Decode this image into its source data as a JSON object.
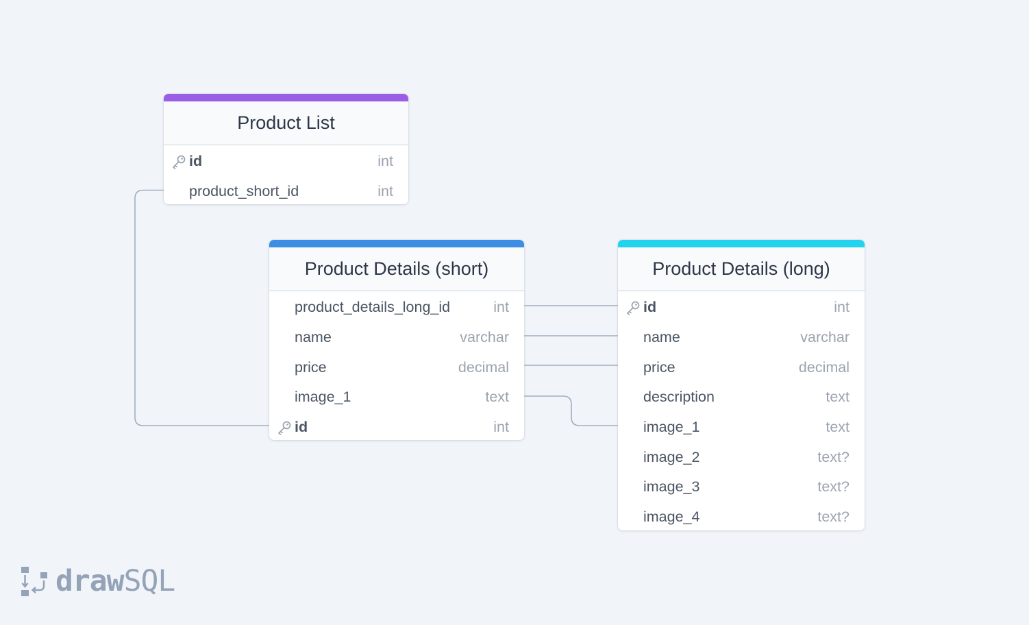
{
  "tables": {
    "product_list": {
      "title": "Product List",
      "accent": "#9b5de5",
      "columns": [
        {
          "name": "id",
          "type": "int",
          "primary_key": true
        },
        {
          "name": "product_short_id",
          "type": "int",
          "primary_key": false
        }
      ]
    },
    "product_details_short": {
      "title": "Product Details (short)",
      "accent": "#3b8ee3",
      "columns": [
        {
          "name": "product_details_long_id",
          "type": "int",
          "primary_key": false
        },
        {
          "name": "name",
          "type": "varchar",
          "primary_key": false
        },
        {
          "name": "price",
          "type": "decimal",
          "primary_key": false
        },
        {
          "name": "image_1",
          "type": "text",
          "primary_key": false
        },
        {
          "name": "id",
          "type": "int",
          "primary_key": true
        }
      ]
    },
    "product_details_long": {
      "title": "Product Details (long)",
      "accent": "#22d3ee",
      "columns": [
        {
          "name": "id",
          "type": "int",
          "primary_key": true
        },
        {
          "name": "name",
          "type": "varchar",
          "primary_key": false
        },
        {
          "name": "price",
          "type": "decimal",
          "primary_key": false
        },
        {
          "name": "description",
          "type": "text",
          "primary_key": false
        },
        {
          "name": "image_1",
          "type": "text",
          "primary_key": false
        },
        {
          "name": "image_2",
          "type": "text?",
          "primary_key": false
        },
        {
          "name": "image_3",
          "type": "text?",
          "primary_key": false
        },
        {
          "name": "image_4",
          "type": "text?",
          "primary_key": false
        }
      ]
    }
  },
  "relations": [
    {
      "from": "product_list.product_short_id",
      "to": "product_details_short.id"
    },
    {
      "from": "product_details_short.product_details_long_id",
      "to": "product_details_long.id"
    },
    {
      "from": "product_details_short.name",
      "to": "product_details_long.name"
    },
    {
      "from": "product_details_short.price",
      "to": "product_details_long.price"
    },
    {
      "from": "product_details_short.image_1",
      "to": "product_details_long.image_1"
    }
  ],
  "logo": {
    "bold_text": "draw",
    "light_text": "SQL"
  },
  "colors": {
    "background": "#f1f5f9",
    "connector": "#a0aec0",
    "key_icon": "#9ca3af"
  }
}
